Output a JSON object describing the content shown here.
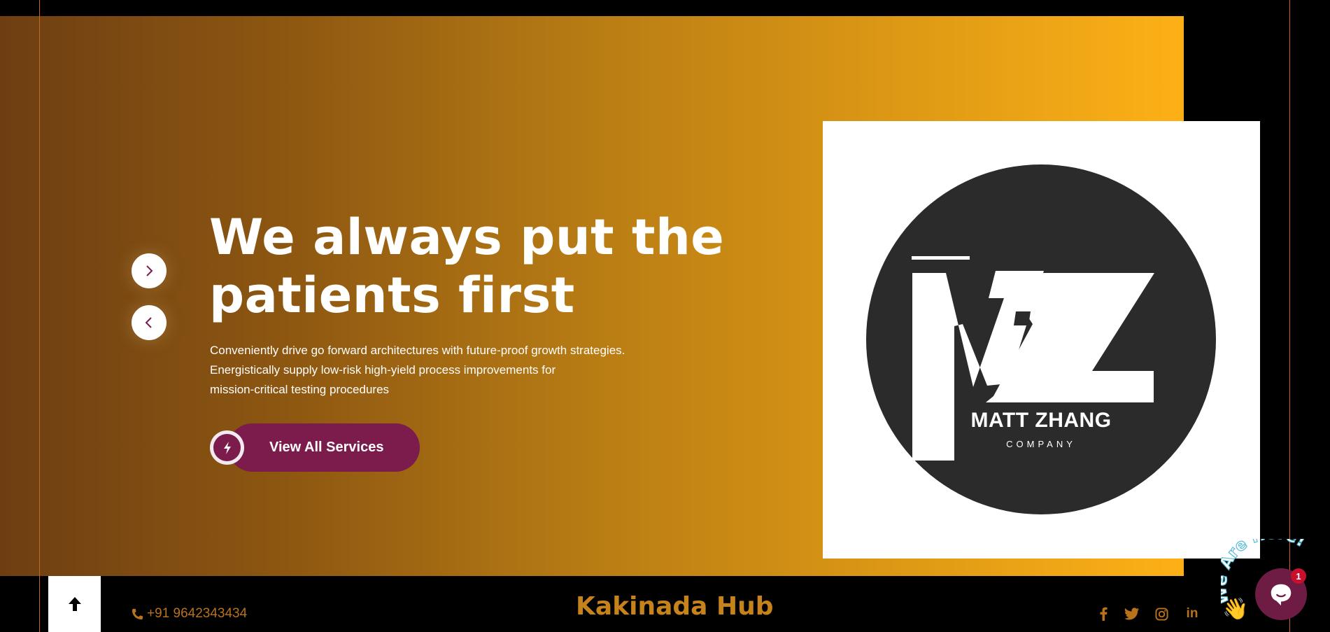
{
  "hero": {
    "headline_line1": "We always put the",
    "headline_line2": "patients first",
    "description_line1": "Conveniently drive go forward architectures with future-proof growth strategies.",
    "description_line2": "Energistically supply low-risk high-yield process improvements for",
    "description_line3": "mission-critical testing procedures",
    "cta_label": "View All Services",
    "nav_next_icon": "chevron-right-icon",
    "nav_prev_icon": "chevron-left-icon",
    "cta_icon": "lightning-bolt-icon"
  },
  "logo": {
    "brand": "MATT ZHANG",
    "sub": "COMPANY"
  },
  "topbar": {
    "phone": "+91 9642343434",
    "site_title": "Kakinada Hub",
    "scroll_top_icon": "arrow-up-icon",
    "social": [
      {
        "name": "facebook-icon"
      },
      {
        "name": "twitter-icon"
      },
      {
        "name": "instagram-icon"
      },
      {
        "name": "linkedin-icon",
        "text": "in"
      }
    ]
  },
  "chat": {
    "callout": "We Are Here!",
    "badge_count": "1",
    "wave_emoji": "👋"
  },
  "colors": {
    "hero_gradient_start": "#6e3e12",
    "hero_gradient_end": "#fdb016",
    "cta": "#7b1c4c",
    "accent_gold": "#c7831b",
    "chat": "#6e1c44",
    "badge": "#c8102e"
  }
}
